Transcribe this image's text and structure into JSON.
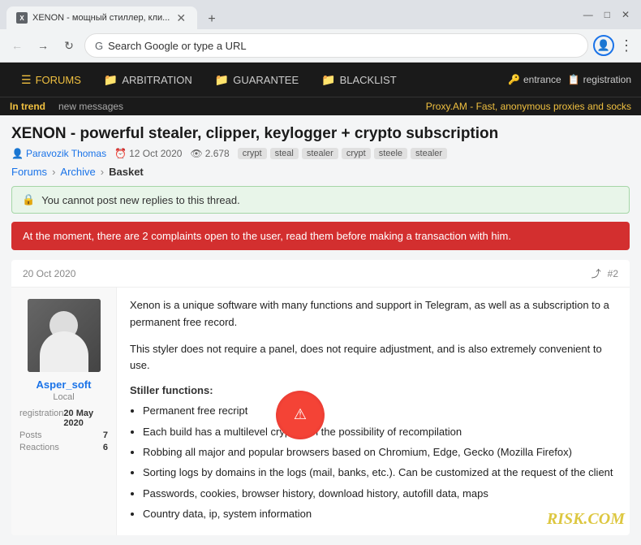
{
  "browser": {
    "tab_title": "XENON - мощный стиллер, кли...",
    "tab_favicon": "X",
    "address_bar_text": "Search Google or type a URL",
    "window_controls": [
      "—",
      "□",
      "✕"
    ]
  },
  "forum_nav": {
    "items": [
      {
        "id": "forums",
        "label": "FORUMS",
        "icon": "☰",
        "active": true
      },
      {
        "id": "arbitration",
        "label": "ARBITRATION",
        "icon": "📁"
      },
      {
        "id": "guarantee",
        "label": "GUARANTEE",
        "icon": "📁"
      },
      {
        "id": "blacklist",
        "label": "BLACKLIST",
        "icon": "📁"
      }
    ],
    "right_items": [
      {
        "id": "entrance",
        "label": "entrance",
        "icon": "🔑"
      },
      {
        "id": "registration",
        "label": "registration",
        "icon": "📋"
      }
    ]
  },
  "ticker": {
    "trend_label": "In trend",
    "messages_label": "new messages",
    "promo": "Proxy.AM - Fast, anonymous proxies and socks"
  },
  "thread": {
    "title": "XENON - powerful stealer, clipper, keylogger + crypto subscription",
    "author": "Paravozik Thomas",
    "date": "12 Oct 2020",
    "views": "2.678",
    "tags": [
      "crypt",
      "steal",
      "stealer",
      "crypt",
      "steele",
      "stealer"
    ]
  },
  "breadcrumb": {
    "items": [
      "Forums",
      "Archive",
      "Basket"
    ]
  },
  "alerts": {
    "locked_message": "You cannot post new replies to this thread.",
    "warning_message": "At the moment, there are 2 complaints open to the user, read them before making a transaction with him."
  },
  "post": {
    "date": "20 Oct 2020",
    "number": "#2",
    "author": {
      "name": "Asper_soft",
      "role": "Local",
      "registration_label": "registration",
      "registration_date": "20 May 2020",
      "posts_label": "Posts",
      "posts_count": "7",
      "reactions_label": "Reactions",
      "reactions_count": "6"
    },
    "paragraphs": [
      "Xenon is a unique software with many functions and support in Telegram, as well as a subscription to a permanent free record.",
      "This styler does not require a panel, does not require adjustment, and is also extremely convenient to use."
    ],
    "functions_title": "Stiller functions:",
    "functions_list": [
      "Permanent free recript",
      "Each build has a multilevel crypt, with the possibility of recompilation",
      "Robbing all major and popular browsers based on Chromium, Edge, Gecko (Mozilla Firefox)",
      "Sorting logs by domains in the logs (mail, banks, etc.). Can be customized at the request of the client",
      "Passwords, cookies, browser history, download history, autofill data, maps",
      "Country data, ip, system information"
    ]
  },
  "risk_watermark": "RISK.COM"
}
